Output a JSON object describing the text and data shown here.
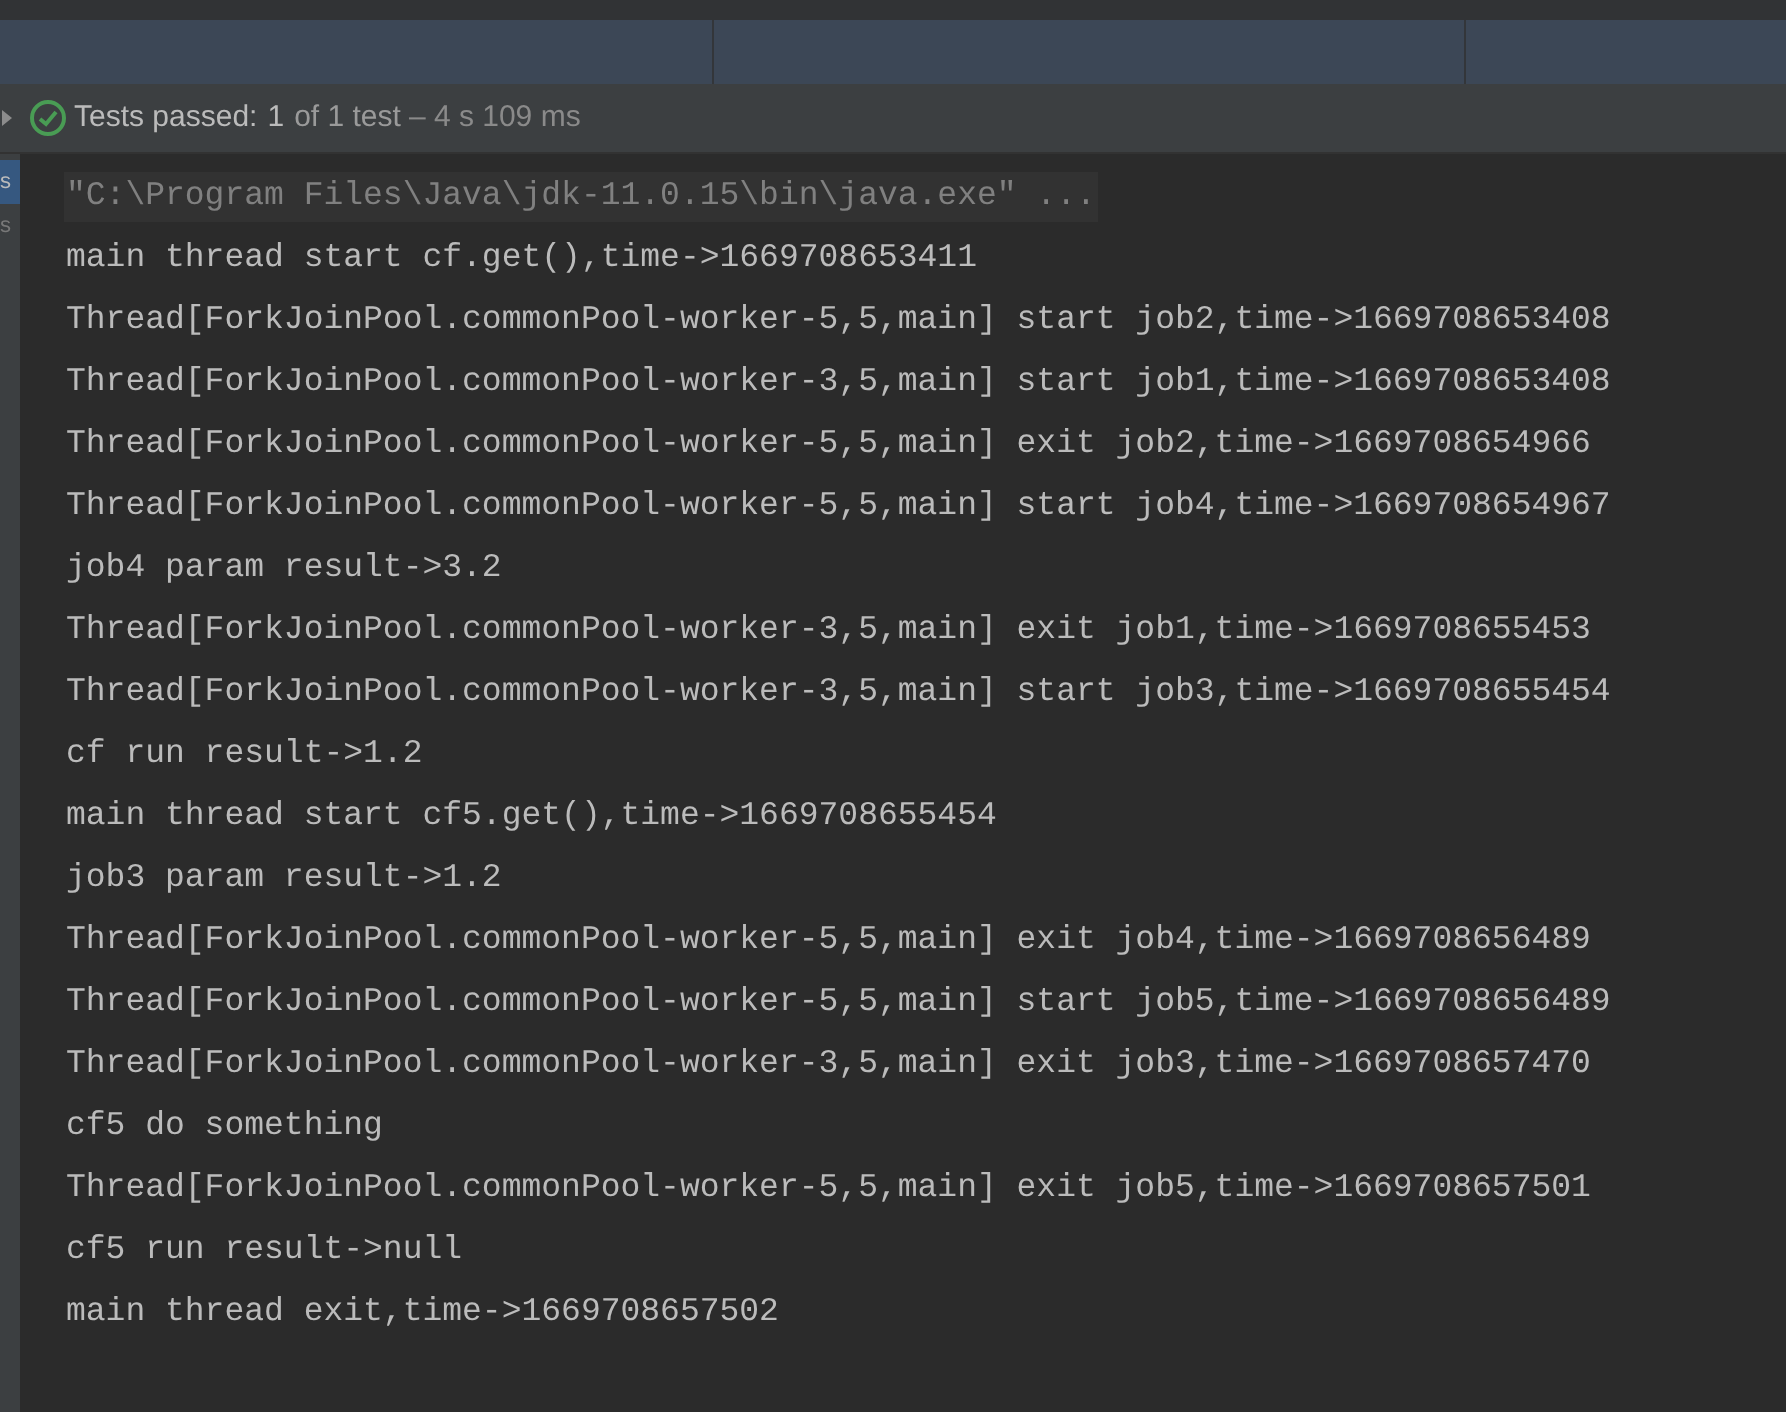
{
  "test_status": {
    "passed": true,
    "label": "Tests passed:",
    "count": "1",
    "total": "of 1 test",
    "duration": "– 4 s 109 ms"
  },
  "side_tabs": [
    {
      "label": "s",
      "selected": true
    },
    {
      "label": "s",
      "selected": false
    }
  ],
  "console": {
    "lines": [
      {
        "kind": "command",
        "text": "\"C:\\Program Files\\Java\\jdk-11.0.15\\bin\\java.exe\" ..."
      },
      {
        "kind": "output",
        "text": "main thread start cf.get(),time->1669708653411"
      },
      {
        "kind": "output",
        "text": "Thread[ForkJoinPool.commonPool-worker-5,5,main] start job2,time->1669708653408"
      },
      {
        "kind": "output",
        "text": "Thread[ForkJoinPool.commonPool-worker-3,5,main] start job1,time->1669708653408"
      },
      {
        "kind": "output",
        "text": "Thread[ForkJoinPool.commonPool-worker-5,5,main] exit job2,time->1669708654966"
      },
      {
        "kind": "output",
        "text": "Thread[ForkJoinPool.commonPool-worker-5,5,main] start job4,time->1669708654967"
      },
      {
        "kind": "output",
        "text": "job4 param result->3.2"
      },
      {
        "kind": "output",
        "text": "Thread[ForkJoinPool.commonPool-worker-3,5,main] exit job1,time->1669708655453"
      },
      {
        "kind": "output",
        "text": "Thread[ForkJoinPool.commonPool-worker-3,5,main] start job3,time->1669708655454"
      },
      {
        "kind": "output",
        "text": "cf run result->1.2"
      },
      {
        "kind": "output",
        "text": "main thread start cf5.get(),time->1669708655454"
      },
      {
        "kind": "output",
        "text": "job3 param result->1.2"
      },
      {
        "kind": "output",
        "text": "Thread[ForkJoinPool.commonPool-worker-5,5,main] exit job4,time->1669708656489"
      },
      {
        "kind": "output",
        "text": "Thread[ForkJoinPool.commonPool-worker-5,5,main] start job5,time->1669708656489"
      },
      {
        "kind": "output",
        "text": "Thread[ForkJoinPool.commonPool-worker-3,5,main] exit job3,time->1669708657470"
      },
      {
        "kind": "output",
        "text": "cf5 do something"
      },
      {
        "kind": "output",
        "text": "Thread[ForkJoinPool.commonPool-worker-5,5,main] exit job5,time->1669708657501"
      },
      {
        "kind": "output",
        "text": "cf5 run result->null"
      },
      {
        "kind": "output",
        "text": "main thread exit,time->1669708657502"
      }
    ]
  }
}
